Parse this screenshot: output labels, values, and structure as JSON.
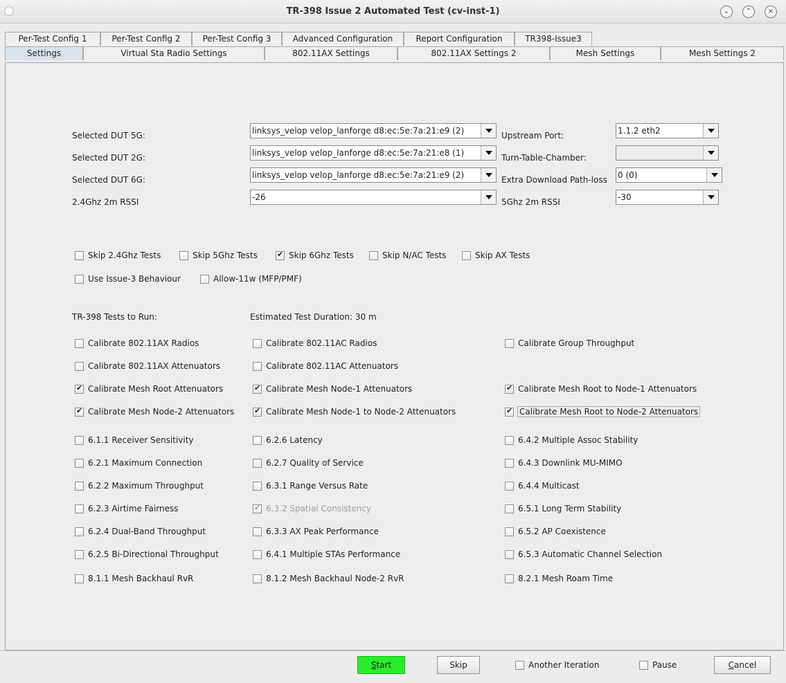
{
  "window": {
    "title": "TR-398 Issue 2 Automated Test  (cv-inst-1)"
  },
  "tabs_row1": [
    "Per-Test Config 1",
    "Per-Test Config 2",
    "Per-Test Config 3",
    "Advanced Configuration",
    "Report Configuration",
    "TR398-Issue3"
  ],
  "tabs_row2": [
    "Settings",
    "Virtual Sta Radio Settings",
    "802.11AX Settings",
    "802.11AX Settings 2",
    "Mesh Settings",
    "Mesh Settings 2"
  ],
  "fields": {
    "dut5g": {
      "label": "Selected DUT 5G:",
      "value": "linksys_velop velop_lanforge d8:ec:5e:7a:21:e9 (2)"
    },
    "dut2g": {
      "label": "Selected DUT 2G:",
      "value": "linksys_velop velop_lanforge d8:ec:5e:7a:21:e8 (1)"
    },
    "dut6g": {
      "label": "Selected DUT 6G:",
      "value": "linksys_velop velop_lanforge d8:ec:5e:7a:21:e9 (2)"
    },
    "rssi24": {
      "label": "2.4Ghz 2m RSSI",
      "value": "-26"
    },
    "upstream": {
      "label": "Upstream Port:",
      "value": "1.1.2 eth2"
    },
    "turntable": {
      "label": "Turn-Table-Chamber:",
      "value": ""
    },
    "pathloss": {
      "label": "Extra Download Path-loss",
      "value": "0 (0)"
    },
    "rssi5": {
      "label": "5Ghz 2m RSSI",
      "value": "-30"
    }
  },
  "options": {
    "skip24": {
      "label": "Skip 2.4Ghz Tests",
      "checked": false
    },
    "skip5": {
      "label": "Skip 5Ghz Tests",
      "checked": false
    },
    "skip6": {
      "label": "Skip 6Ghz Tests",
      "checked": true
    },
    "skipnac": {
      "label": "Skip N/AC Tests",
      "checked": false
    },
    "skipax": {
      "label": "Skip AX Tests",
      "checked": false
    },
    "issue3": {
      "label": "Use Issue-3 Behaviour",
      "checked": false
    },
    "allow11w": {
      "label": "Allow-11w (MFP/PMF)",
      "checked": false
    }
  },
  "tests_header": "TR-398 Tests to Run:",
  "duration": "Estimated Test Duration: 30 m",
  "tests": {
    "cal_ax_radios": {
      "label": "Calibrate 802.11AX Radios",
      "checked": false
    },
    "cal_ac_radios": {
      "label": "Calibrate 802.11AC Radios",
      "checked": false
    },
    "cal_group_tp": {
      "label": "Calibrate Group Throughput",
      "checked": false
    },
    "cal_ax_att": {
      "label": "Calibrate 802.11AX Attenuators",
      "checked": false
    },
    "cal_ac_att": {
      "label": "Calibrate 802.11AC Attenuators",
      "checked": false
    },
    "cal_mesh_root": {
      "label": "Calibrate Mesh Root Attenuators",
      "checked": true
    },
    "cal_mesh_node1": {
      "label": "Calibrate Mesh Node-1 Attenuators",
      "checked": true
    },
    "cal_root_node1": {
      "label": "Calibrate Mesh Root to Node-1 Attenuators",
      "checked": true
    },
    "cal_mesh_node2": {
      "label": "Calibrate Mesh Node-2 Attenuators",
      "checked": true
    },
    "cal_node1_node2": {
      "label": "Calibrate Mesh Node-1 to Node-2 Attenuators",
      "checked": true
    },
    "cal_root_node2": {
      "label": "Calibrate Mesh Root to Node-2 Attenuators",
      "checked": true
    },
    "t611": {
      "label": "6.1.1 Receiver Sensitivity",
      "checked": false
    },
    "t626": {
      "label": "6.2.6 Latency",
      "checked": false
    },
    "t642": {
      "label": "6.4.2 Multiple Assoc Stability",
      "checked": false
    },
    "t621": {
      "label": "6.2.1 Maximum Connection",
      "checked": false
    },
    "t627": {
      "label": "6.2.7 Quality of Service",
      "checked": false
    },
    "t643": {
      "label": "6.4.3 Downlink MU-MIMO",
      "checked": false
    },
    "t622": {
      "label": "6.2.2 Maximum Throughput",
      "checked": false
    },
    "t631": {
      "label": "6.3.1 Range Versus Rate",
      "checked": false
    },
    "t644": {
      "label": "6.4.4 Multicast",
      "checked": false
    },
    "t623": {
      "label": "6.2.3 Airtime Fairness",
      "checked": false
    },
    "t632": {
      "label": "6.3.2 Spatial Consistency",
      "checked": true
    },
    "t651": {
      "label": "6.5.1 Long Term Stability",
      "checked": false
    },
    "t624": {
      "label": "6.2.4 Dual-Band Throughput",
      "checked": false
    },
    "t633": {
      "label": "6.3.3 AX Peak Performance",
      "checked": false
    },
    "t652": {
      "label": "6.5.2 AP Coexistence",
      "checked": false
    },
    "t625": {
      "label": "6.2.5 Bi-Directional Throughput",
      "checked": false
    },
    "t641": {
      "label": "6.4.1 Multiple STAs Performance",
      "checked": false
    },
    "t653": {
      "label": "6.5.3 Automatic Channel Selection",
      "checked": false
    },
    "t811": {
      "label": "8.1.1 Mesh Backhaul RvR",
      "checked": false
    },
    "t812": {
      "label": "8.1.2 Mesh Backhaul Node-2 RvR",
      "checked": false
    },
    "t821": {
      "label": "8.2.1 Mesh Roam Time",
      "checked": false
    }
  },
  "buttons": {
    "start_mn": "S",
    "start_rest": "tart",
    "skip": "Skip",
    "another_iteration": {
      "label": "Another Iteration",
      "checked": false
    },
    "pause": {
      "label": "Pause",
      "checked": false
    },
    "cancel_mn": "C",
    "cancel_rest": "ancel"
  },
  "colors": {
    "start_button": "#28ee28",
    "selected_tab": "#d8e3ee"
  }
}
